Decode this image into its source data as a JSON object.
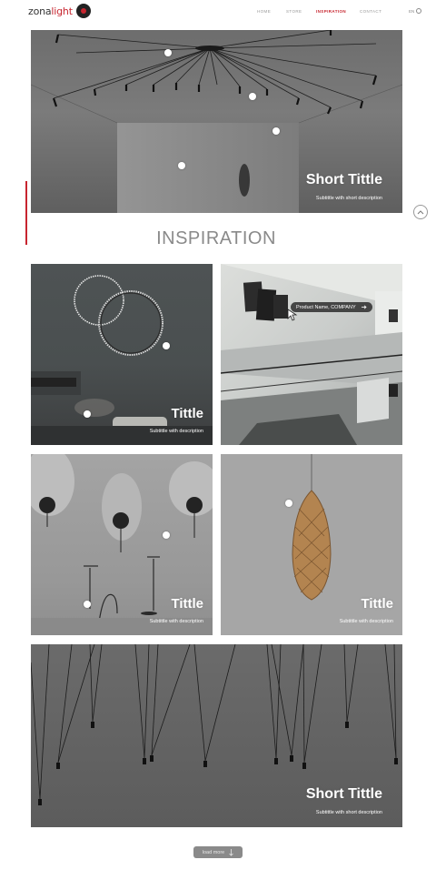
{
  "brand": {
    "name_part1": "zona",
    "name_part2": "light"
  },
  "nav": [
    {
      "label": "HOME",
      "active": false
    },
    {
      "label": "STORE",
      "active": false
    },
    {
      "label": "INSPIRATION",
      "active": true
    },
    {
      "label": "CONTACT",
      "active": false
    }
  ],
  "language": {
    "label": "EN",
    "icon": "globe-icon"
  },
  "hero": {
    "title": "Short Tittle",
    "subtitle": "Subtittle with short description"
  },
  "section_title": "INSPIRATION",
  "cards": [
    {
      "title": "Tittle",
      "subtitle": "Subtittle with description"
    },
    {
      "product_tag": "Product Name, COMPANY",
      "tag_icon": "arrow-right-icon"
    },
    {
      "title": "Tittle",
      "subtitle": "Subtittle with description"
    },
    {
      "title": "Tittle",
      "subtitle": "Subtittle with description"
    }
  ],
  "wide_card": {
    "title": "Short Tittle",
    "subtitle": "Subtittle with short description"
  },
  "load_more": {
    "label": "load more",
    "icon": "arrow-down-icon"
  },
  "scroll_top": {
    "icon": "chevron-up-icon"
  },
  "colors": {
    "accent": "#c7252f",
    "text_gray": "#8a8a8a"
  }
}
